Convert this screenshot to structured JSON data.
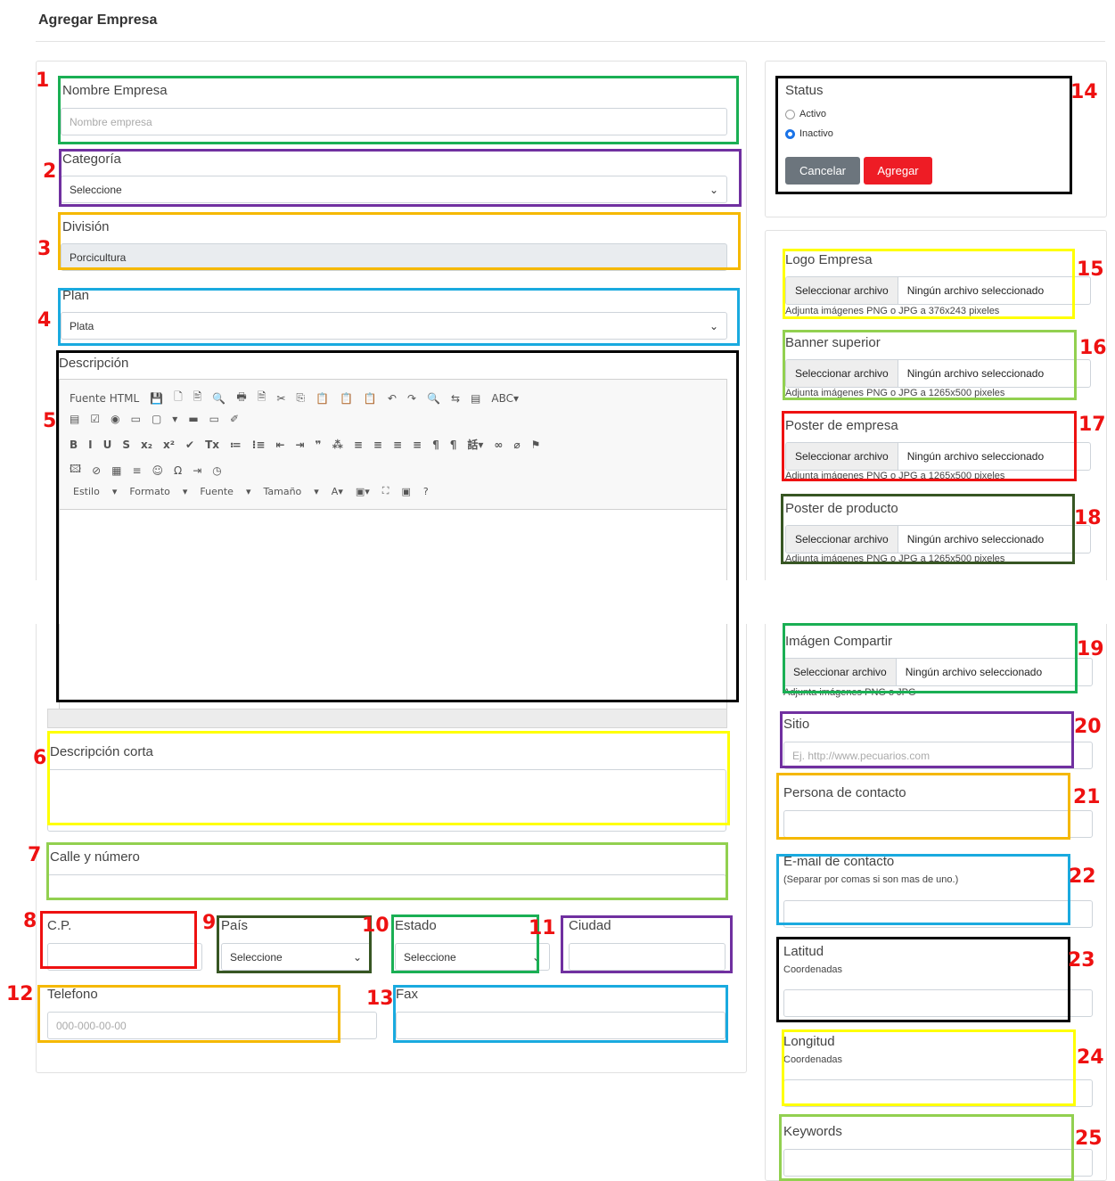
{
  "page": {
    "title": "Agregar Empresa"
  },
  "form": {
    "nombre": {
      "label": "Nombre Empresa",
      "placeholder": "Nombre empresa"
    },
    "categoria": {
      "label": "Categoría",
      "value": "Seleccione"
    },
    "division": {
      "label": "División",
      "value": "Porcicultura"
    },
    "plan": {
      "label": "Plan",
      "value": "Plata"
    },
    "descripcion": {
      "label": "Descripción"
    },
    "descripcion_corta": {
      "label": "Descripción corta"
    },
    "calle": {
      "label": "Calle y número"
    },
    "cp": {
      "label": "C.P."
    },
    "pais": {
      "label": "País",
      "value": "Seleccione"
    },
    "estado": {
      "label": "Estado",
      "value": "Seleccione"
    },
    "ciudad": {
      "label": "Ciudad"
    },
    "telefono": {
      "label": "Telefono",
      "placeholder": "000-000-00-00"
    },
    "fax": {
      "label": "Fax"
    }
  },
  "editor": {
    "row1": [
      "Fuente HTML",
      "💾",
      "🗋",
      "🖹",
      "🔍",
      "🖶",
      "🗎",
      "✂",
      "⎘",
      "📋",
      "📋",
      "📋",
      "↶",
      "↷",
      "🔍",
      "⇆",
      "▤",
      "ABC▾"
    ],
    "row2": [
      "▤",
      "☑",
      "◉",
      "▭",
      "▢",
      "▾",
      "▬",
      "▭",
      "✐"
    ],
    "row3": [
      "B",
      "I",
      "U",
      "S",
      "x₂",
      "x²",
      "✔",
      "Tx",
      "≔",
      "⁝≡",
      "⇤",
      "⇥",
      "❞",
      "⁂",
      "≡",
      "≡",
      "≡",
      "≡",
      "¶",
      "¶",
      "話▾",
      "∞",
      "⌀",
      "⚑"
    ],
    "row4": [
      "🖾",
      "⊘",
      "▦",
      "≡",
      "☺",
      "Ω",
      "⇥",
      "◷"
    ],
    "row5": [
      "Estilo",
      "▾",
      "Formato",
      "▾",
      "Fuente",
      "▾",
      "Tamaño",
      "▾",
      "A▾",
      "▣▾",
      "⛶",
      "▣",
      "?"
    ]
  },
  "status": {
    "label": "Status",
    "options": [
      "Activo",
      "Inactivo"
    ],
    "selected": "Inactivo",
    "cancel": "Cancelar",
    "add": "Agregar"
  },
  "files": {
    "button": "Seleccionar archivo",
    "none": "Ningún archivo seleccionado",
    "logo": {
      "label": "Logo Empresa",
      "hint": "Adjunta imágenes PNG o JPG a 376x243 pixeles"
    },
    "banner": {
      "label": "Banner superior",
      "hint": "Adjunta imágenes PNG o JPG a 1265x500 pixeles"
    },
    "poster_empresa": {
      "label": "Poster de empresa",
      "hint": "Adjunta imágenes PNG o JPG a 1265x500 pixeles"
    },
    "poster_producto": {
      "label": "Poster de producto",
      "hint": "Adjunta imágenes PNG o JPG a 1265x500 pixeles"
    },
    "compartir": {
      "label": "Imágen Compartir",
      "hint": "Adjunta imágenes PNG o JPG"
    }
  },
  "side": {
    "sitio": {
      "label": "Sitio",
      "placeholder": "Ej. http://www.pecuarios.com"
    },
    "contacto": {
      "label": "Persona de contacto"
    },
    "email": {
      "label": "E-mail de contacto",
      "sub": "(Separar por comas si son mas de uno.)"
    },
    "latitud": {
      "label": "Latitud",
      "sub": "Coordenadas"
    },
    "longitud": {
      "label": "Longitud",
      "sub": "Coordenadas"
    },
    "keywords": {
      "label": "Keywords"
    }
  },
  "annotations": [
    "1",
    "2",
    "3",
    "4",
    "5",
    "6",
    "7",
    "8",
    "9",
    "10",
    "11",
    "12",
    "13",
    "14",
    "15",
    "16",
    "17",
    "18",
    "19",
    "20",
    "21",
    "22",
    "23",
    "24",
    "25"
  ],
  "colors": {
    "green": "#1aaf54",
    "purple": "#7030a0",
    "orange": "#f5b800",
    "cyan": "#1aaadf",
    "black": "#000000",
    "yellow": "#ffff00",
    "lightgreen": "#92d050",
    "red": "#ee1111",
    "darkgreen": "#375623",
    "primary_btn": "#ee1c25",
    "secondary_btn": "#6c757d"
  }
}
